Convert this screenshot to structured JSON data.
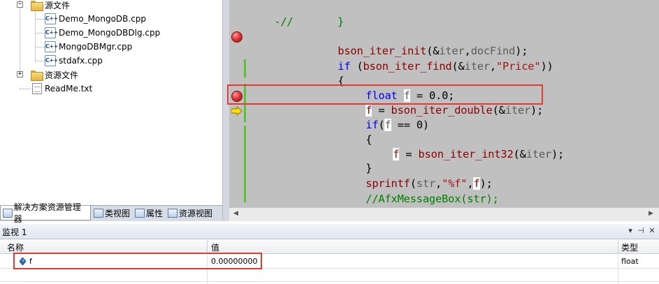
{
  "solution_explorer": {
    "folders": [
      {
        "label": "源文件",
        "state": "expanded"
      },
      {
        "label": "资源文件",
        "state": "collapsed"
      }
    ],
    "files": [
      "Demo_MongoDB.cpp",
      "Demo_MongoDBDlg.cpp",
      "MongoDBMgr.cpp",
      "stdafx.cpp"
    ],
    "readme": "ReadMe.txt",
    "cpp_badge": "C++"
  },
  "tabs": [
    {
      "label": "解决方案资源管理器",
      "icon": "solution-explorer-icon",
      "active": true
    },
    {
      "label": "类视图",
      "icon": "class-view-icon",
      "active": false
    },
    {
      "label": "属性",
      "icon": "properties-icon",
      "active": false
    },
    {
      "label": "资源视图",
      "icon": "resource-view-icon",
      "active": false
    }
  ],
  "code": {
    "line0": {
      "prefix": "-//",
      "brace": "}"
    },
    "line2": {
      "fn": "bson_iter_init",
      "open": "(&",
      "arg1": "iter",
      "comma": ",",
      "arg2": "docFind",
      "close": ");"
    },
    "line3": {
      "kw": "if",
      "open": " (",
      "fn": "bson_iter_find",
      "amp": "(&",
      "arg": "iter",
      "comma": ",",
      "str": "\"Price\"",
      "close": "))"
    },
    "line4": {
      "brace": "{"
    },
    "line5": {
      "kw": "float",
      "var": "f",
      "rest": " = 0.0;"
    },
    "line6": {
      "var": "f",
      "eq": " = ",
      "fn": "bson_iter_double",
      "amp": "(&",
      "arg": "iter",
      "close": ");"
    },
    "line7": {
      "kw": "if",
      "open": "(",
      "var": "f",
      "rest": " == 0)"
    },
    "line8": {
      "brace": "{"
    },
    "line9": {
      "var": "f",
      "eq": " = ",
      "fn": "bson_iter_int32",
      "amp": "(&",
      "arg": "iter",
      "close": ");"
    },
    "line10": {
      "brace": "}"
    },
    "line11": {
      "fn": "sprintf",
      "open": "(",
      "arg1": "str",
      "comma": ",",
      "str": "\"%f\"",
      "comma2": ",",
      "var": "f",
      "close": ");"
    },
    "line12": {
      "comment": "//AfxMessageBox(str);"
    },
    "line13": {
      "brace": "}"
    }
  },
  "watch": {
    "title": "监视 1",
    "pin_icon": "pin-icon",
    "close_icon": "close-icon",
    "columns": {
      "name": "名称",
      "value": "值",
      "type": "类型"
    },
    "rows": [
      {
        "name": "f",
        "value": "0.00000000",
        "type": "float"
      }
    ]
  },
  "colors": {
    "annotation": "#e53935",
    "editor_bg": "#c0c0c0",
    "keyword": "#0000ff",
    "function": "#8b0000",
    "comment": "#008000",
    "string": "#a31515"
  }
}
